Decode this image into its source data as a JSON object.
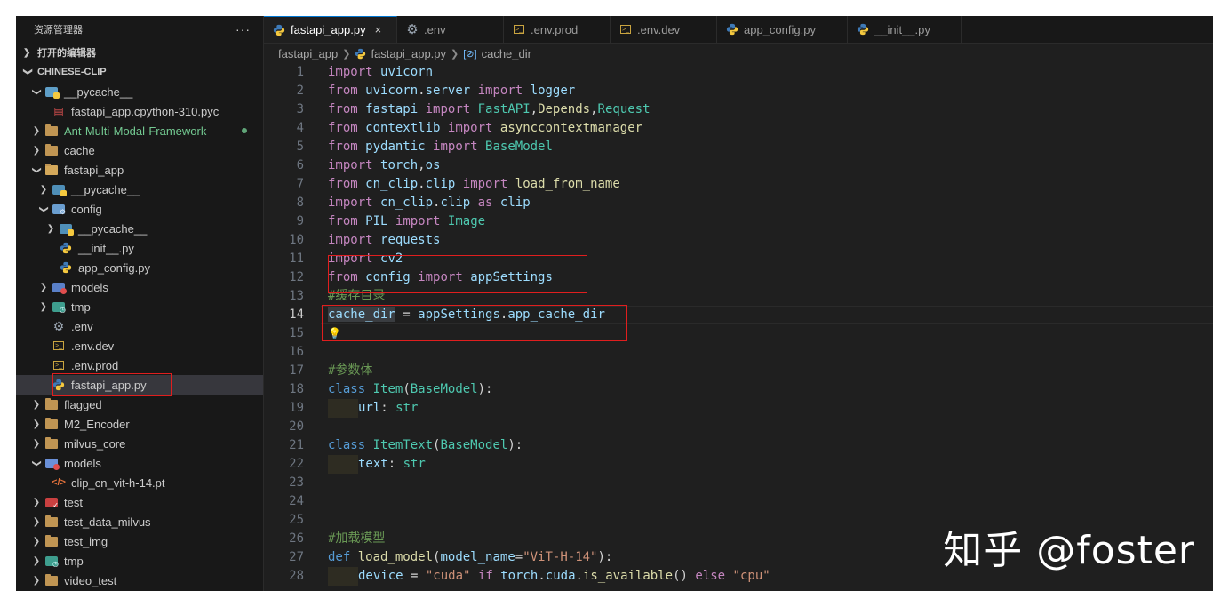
{
  "explorer": {
    "title": "资源管理器",
    "more": "···",
    "open_editors": "打开的编辑器",
    "project": "CHINESE-CLIP",
    "items": [
      {
        "label": "__pycache__",
        "depth": 1,
        "kind": "pyfolder-open",
        "chev": "open"
      },
      {
        "label": "fastapi_app.cpython-310.pyc",
        "depth": 2,
        "kind": "pyc"
      },
      {
        "label": "Ant-Multi-Modal-Framework",
        "depth": 1,
        "kind": "folder",
        "chev": "closed",
        "color": "#73c991"
      },
      {
        "label": "cache",
        "depth": 1,
        "kind": "folder",
        "chev": "closed"
      },
      {
        "label": "fastapi_app",
        "depth": 1,
        "kind": "folder-open",
        "chev": "open"
      },
      {
        "label": "__pycache__",
        "depth": 2,
        "kind": "pyfolder",
        "chev": "closed"
      },
      {
        "label": "config",
        "depth": 2,
        "kind": "cfgfolder-open",
        "chev": "open"
      },
      {
        "label": "__pycache__",
        "depth": 3,
        "kind": "pyfolder",
        "chev": "closed"
      },
      {
        "label": "__init__.py",
        "depth": 3,
        "kind": "py"
      },
      {
        "label": "app_config.py",
        "depth": 3,
        "kind": "py"
      },
      {
        "label": "models",
        "depth": 2,
        "kind": "modelfolder",
        "chev": "closed"
      },
      {
        "label": "tmp",
        "depth": 2,
        "kind": "tmpfolder",
        "chev": "closed"
      },
      {
        "label": ".env",
        "depth": 2,
        "kind": "gear"
      },
      {
        "label": ".env.dev",
        "depth": 2,
        "kind": "term"
      },
      {
        "label": ".env.prod",
        "depth": 2,
        "kind": "term"
      },
      {
        "label": "fastapi_app.py",
        "depth": 2,
        "kind": "py",
        "selected": true
      },
      {
        "label": "flagged",
        "depth": 1,
        "kind": "folder",
        "chev": "closed"
      },
      {
        "label": "M2_Encoder",
        "depth": 1,
        "kind": "folder",
        "chev": "closed"
      },
      {
        "label": "milvus_core",
        "depth": 1,
        "kind": "folder",
        "chev": "closed"
      },
      {
        "label": "models",
        "depth": 1,
        "kind": "modelfolder-open",
        "chev": "open"
      },
      {
        "label": "clip_cn_vit-h-14.pt",
        "depth": 2,
        "kind": "pt"
      },
      {
        "label": "test",
        "depth": 1,
        "kind": "testfolder",
        "chev": "closed"
      },
      {
        "label": "test_data_milvus",
        "depth": 1,
        "kind": "folder",
        "chev": "closed"
      },
      {
        "label": "test_img",
        "depth": 1,
        "kind": "folder",
        "chev": "closed"
      },
      {
        "label": "tmp",
        "depth": 1,
        "kind": "tmpfolder",
        "chev": "closed"
      },
      {
        "label": "video_test",
        "depth": 1,
        "kind": "folder",
        "chev": "closed"
      }
    ]
  },
  "tabs": [
    {
      "label": "fastapi_app.py",
      "icon": "python-icon",
      "active": true,
      "close": "×"
    },
    {
      "label": ".env",
      "icon": "gear-icon"
    },
    {
      "label": ".env.prod",
      "icon": "terminal-icon"
    },
    {
      "label": ".env.dev",
      "icon": "terminal-icon"
    },
    {
      "label": "app_config.py",
      "icon": "python-icon"
    },
    {
      "label": "__init__.py",
      "icon": "python-icon"
    }
  ],
  "breadcrumb": {
    "folder": "fastapi_app",
    "file": "fastapi_app.py",
    "symbol": "cache_dir"
  },
  "editor": {
    "current_line": 14,
    "lines": [
      {
        "n": "1",
        "tokens": [
          [
            "kw",
            "import"
          ],
          [
            "op",
            " "
          ],
          [
            "mod",
            "uvicorn"
          ]
        ]
      },
      {
        "n": "2",
        "tokens": [
          [
            "kw",
            "from"
          ],
          [
            "op",
            " "
          ],
          [
            "mod",
            "uvicorn"
          ],
          [
            "op",
            "."
          ],
          [
            "mod",
            "server"
          ],
          [
            "op",
            " "
          ],
          [
            "kw",
            "import"
          ],
          [
            "op",
            " "
          ],
          [
            "var",
            "logger"
          ]
        ]
      },
      {
        "n": "3",
        "tokens": [
          [
            "kw",
            "from"
          ],
          [
            "op",
            " "
          ],
          [
            "mod",
            "fastapi"
          ],
          [
            "op",
            " "
          ],
          [
            "kw",
            "import"
          ],
          [
            "op",
            " "
          ],
          [
            "cls",
            "FastAPI"
          ],
          [
            "op",
            ","
          ],
          [
            "fn",
            "Depends"
          ],
          [
            "op",
            ","
          ],
          [
            "cls",
            "Request"
          ]
        ]
      },
      {
        "n": "4",
        "tokens": [
          [
            "kw",
            "from"
          ],
          [
            "op",
            " "
          ],
          [
            "mod",
            "contextlib"
          ],
          [
            "op",
            " "
          ],
          [
            "kw",
            "import"
          ],
          [
            "op",
            " "
          ],
          [
            "fn",
            "asynccontextmanager"
          ]
        ]
      },
      {
        "n": "5",
        "tokens": [
          [
            "kw",
            "from"
          ],
          [
            "op",
            " "
          ],
          [
            "mod",
            "pydantic"
          ],
          [
            "op",
            " "
          ],
          [
            "kw",
            "import"
          ],
          [
            "op",
            " "
          ],
          [
            "cls",
            "BaseModel"
          ]
        ]
      },
      {
        "n": "6",
        "tokens": [
          [
            "kw",
            "import"
          ],
          [
            "op",
            " "
          ],
          [
            "mod",
            "torch"
          ],
          [
            "op",
            ","
          ],
          [
            "mod",
            "os"
          ]
        ]
      },
      {
        "n": "7",
        "tokens": [
          [
            "kw",
            "from"
          ],
          [
            "op",
            " "
          ],
          [
            "mod",
            "cn_clip"
          ],
          [
            "op",
            "."
          ],
          [
            "mod",
            "clip"
          ],
          [
            "op",
            " "
          ],
          [
            "kw",
            "import"
          ],
          [
            "op",
            " "
          ],
          [
            "fn",
            "load_from_name"
          ]
        ]
      },
      {
        "n": "8",
        "tokens": [
          [
            "kw",
            "import"
          ],
          [
            "op",
            " "
          ],
          [
            "mod",
            "cn_clip"
          ],
          [
            "op",
            "."
          ],
          [
            "mod",
            "clip"
          ],
          [
            "op",
            " "
          ],
          [
            "kw",
            "as"
          ],
          [
            "op",
            " "
          ],
          [
            "mod",
            "clip"
          ]
        ]
      },
      {
        "n": "9",
        "tokens": [
          [
            "kw",
            "from"
          ],
          [
            "op",
            " "
          ],
          [
            "mod",
            "PIL"
          ],
          [
            "op",
            " "
          ],
          [
            "kw",
            "import"
          ],
          [
            "op",
            " "
          ],
          [
            "cls",
            "Image"
          ]
        ]
      },
      {
        "n": "10",
        "tokens": [
          [
            "kw",
            "import"
          ],
          [
            "op",
            " "
          ],
          [
            "mod",
            "requests"
          ]
        ]
      },
      {
        "n": "11",
        "tokens": [
          [
            "kw",
            "import"
          ],
          [
            "op",
            " "
          ],
          [
            "mod",
            "cv2"
          ]
        ]
      },
      {
        "n": "12",
        "tokens": [
          [
            "kw",
            "from"
          ],
          [
            "op",
            " "
          ],
          [
            "mod",
            "config"
          ],
          [
            "op",
            " "
          ],
          [
            "kw",
            "import"
          ],
          [
            "op",
            " "
          ],
          [
            "var",
            "appSettings"
          ]
        ]
      },
      {
        "n": "13",
        "tokens": [
          [
            "cm",
            "#缓存目录"
          ]
        ]
      },
      {
        "n": "14",
        "tokens": [
          [
            "var hl",
            "cache_dir"
          ],
          [
            "op",
            " = "
          ],
          [
            "var",
            "appSettings"
          ],
          [
            "op",
            "."
          ],
          [
            "var",
            "app_cache_dir"
          ]
        ]
      },
      {
        "n": "15",
        "tokens": [
          [
            "bulb",
            "💡"
          ]
        ]
      },
      {
        "n": "16",
        "tokens": []
      },
      {
        "n": "17",
        "tokens": [
          [
            "cm",
            "#参数体"
          ]
        ]
      },
      {
        "n": "18",
        "tokens": [
          [
            "kb",
            "class"
          ],
          [
            "op",
            " "
          ],
          [
            "cls",
            "Item"
          ],
          [
            "op",
            "("
          ],
          [
            "cls",
            "BaseModel"
          ],
          [
            "op",
            "):"
          ]
        ]
      },
      {
        "n": "19",
        "tokens": [
          [
            "indent",
            ""
          ],
          [
            "var",
            "url"
          ],
          [
            "op",
            ": "
          ],
          [
            "cls",
            "str"
          ]
        ]
      },
      {
        "n": "20",
        "tokens": []
      },
      {
        "n": "21",
        "tokens": [
          [
            "kb",
            "class"
          ],
          [
            "op",
            " "
          ],
          [
            "cls",
            "ItemText"
          ],
          [
            "op",
            "("
          ],
          [
            "cls",
            "BaseModel"
          ],
          [
            "op",
            "):"
          ]
        ]
      },
      {
        "n": "22",
        "tokens": [
          [
            "indent",
            ""
          ],
          [
            "var",
            "text"
          ],
          [
            "op",
            ": "
          ],
          [
            "cls",
            "str"
          ]
        ]
      },
      {
        "n": "23",
        "tokens": []
      },
      {
        "n": "24",
        "tokens": []
      },
      {
        "n": "25",
        "tokens": []
      },
      {
        "n": "26",
        "tokens": [
          [
            "cm",
            "#加载模型"
          ]
        ]
      },
      {
        "n": "27",
        "tokens": [
          [
            "kb",
            "def"
          ],
          [
            "op",
            " "
          ],
          [
            "fn",
            "load_model"
          ],
          [
            "op",
            "("
          ],
          [
            "var",
            "model_name"
          ],
          [
            "op",
            "="
          ],
          [
            "str",
            "\"ViT-H-14\""
          ],
          [
            "op",
            "):"
          ]
        ]
      },
      {
        "n": "28",
        "tokens": [
          [
            "indent",
            ""
          ],
          [
            "var",
            "device"
          ],
          [
            "op",
            " = "
          ],
          [
            "str",
            "\"cuda\""
          ],
          [
            "op",
            " "
          ],
          [
            "kw",
            "if"
          ],
          [
            "op",
            " "
          ],
          [
            "mod",
            "torch"
          ],
          [
            "op",
            "."
          ],
          [
            "mod",
            "cuda"
          ],
          [
            "op",
            "."
          ],
          [
            "fn",
            "is_available"
          ],
          [
            "op",
            "() "
          ],
          [
            "kw",
            "else"
          ],
          [
            "op",
            " "
          ],
          [
            "str",
            "\"cpu\""
          ]
        ]
      }
    ]
  },
  "watermark": "知乎 @foster",
  "colors": {
    "highlight_box": "#e01e1e",
    "active_tab_border": "#0078d4"
  }
}
